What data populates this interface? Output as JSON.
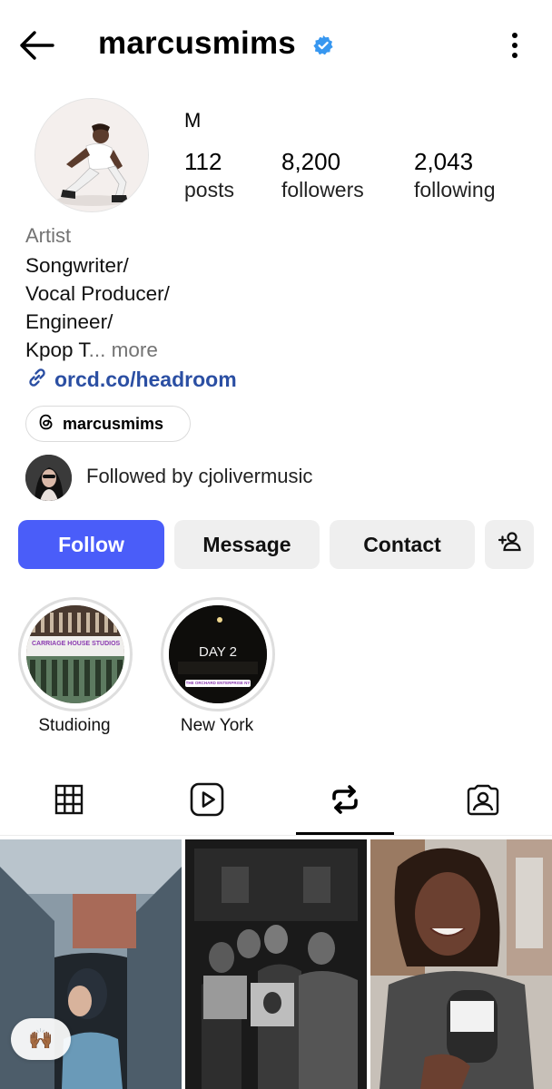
{
  "header": {
    "username": "marcusmims"
  },
  "profile": {
    "display_name": "M",
    "stats": [
      {
        "value": "112",
        "label": "posts"
      },
      {
        "value": "8,200",
        "label": "followers"
      },
      {
        "value": "2,043",
        "label": "following"
      }
    ],
    "category": "Artist",
    "bio_lines": [
      "Songwriter/",
      "Vocal Producer/",
      "Engineer/",
      "Kpop T"
    ],
    "bio_truncation": "... more",
    "link": "orcd.co/headroom",
    "threads_handle": "marcusmims",
    "followed_by": "Followed by cjolivermusic"
  },
  "actions": {
    "follow": "Follow",
    "message": "Message",
    "contact": "Contact"
  },
  "highlights": [
    {
      "label": "Studioing",
      "sticker": "CARRIAGE HOUSE STUDIOS"
    },
    {
      "label": "New York",
      "title": "DAY 2",
      "sticker": "THE ORCHARD ENTERPRISE NY"
    }
  ],
  "tabs": [
    {
      "icon": "grid-icon"
    },
    {
      "icon": "reels-icon"
    },
    {
      "icon": "reposts-icon",
      "active": true
    },
    {
      "icon": "tagged-icon"
    }
  ],
  "reaction_emoji": "🙌🏾",
  "colors": {
    "accent": "#4a5df9",
    "link": "#2b4fa3",
    "verified": "#3797f0"
  }
}
